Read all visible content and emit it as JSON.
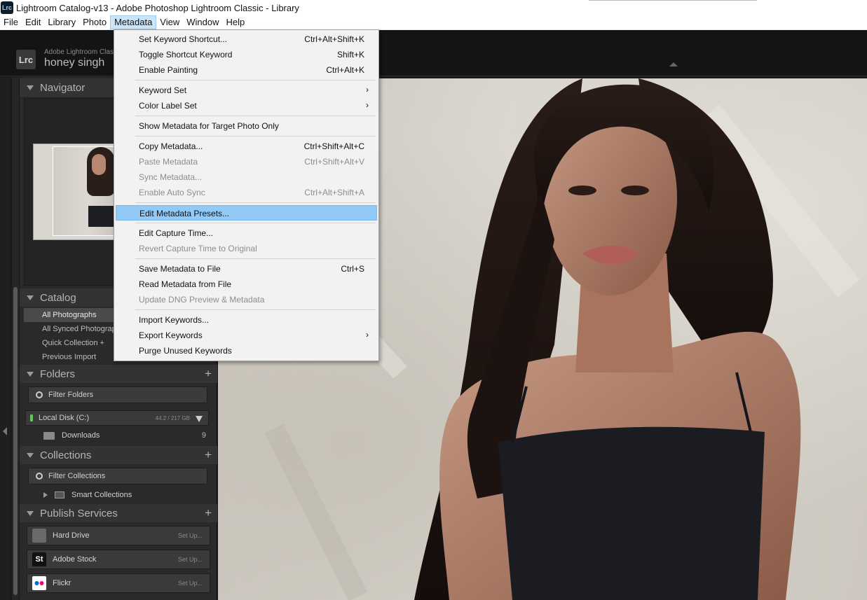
{
  "window": {
    "app_icon": "Lrc",
    "title": "Lightroom Catalog-v13 - Adobe Photoshop Lightroom Classic - Library"
  },
  "menubar": {
    "items": [
      "File",
      "Edit",
      "Library",
      "Photo",
      "Metadata",
      "View",
      "Window",
      "Help"
    ],
    "active": "Metadata"
  },
  "identity": {
    "logo": "Lrc",
    "product": "Adobe Lightroom Class",
    "user": "honey singh"
  },
  "panels": {
    "navigator": "Navigator",
    "catalog": {
      "title": "Catalog",
      "items": [
        "All Photographs",
        "All Synced Photographs",
        "Quick Collection  +",
        "Previous Import"
      ],
      "selected": "All Photographs"
    },
    "folders": {
      "title": "Folders",
      "filter_placeholder": "Filter Folders",
      "disk_name": "Local Disk (C:)",
      "disk_size": "44.2 / 217 GB",
      "folder_name": "Downloads",
      "folder_count": "9"
    },
    "collections": {
      "title": "Collections",
      "filter_placeholder": "Filter Collections",
      "set_name": "Smart Collections"
    },
    "publish": {
      "title": "Publish Services",
      "services": [
        {
          "name": "Hard Drive",
          "setup": "Set Up..."
        },
        {
          "name": "Adobe Stock",
          "setup": "Set Up...",
          "icon_text": "St"
        },
        {
          "name": "Flickr",
          "setup": "Set Up..."
        }
      ]
    }
  },
  "metadata_menu": {
    "items": [
      {
        "label": "Set Keyword Shortcut...",
        "shortcut": "Ctrl+Alt+Shift+K"
      },
      {
        "label": "Toggle Shortcut Keyword",
        "shortcut": "Shift+K"
      },
      {
        "label": "Enable Painting",
        "shortcut": "Ctrl+Alt+K"
      },
      {
        "label": "Keyword Set",
        "submenu": true
      },
      {
        "label": "Color Label Set",
        "submenu": true
      },
      {
        "label": "Show Metadata for Target Photo Only"
      },
      {
        "label": "Copy Metadata...",
        "shortcut": "Ctrl+Shift+Alt+C"
      },
      {
        "label": "Paste Metadata",
        "shortcut": "Ctrl+Shift+Alt+V",
        "disabled": true
      },
      {
        "label": "Sync Metadata...",
        "disabled": true
      },
      {
        "label": "Enable Auto Sync",
        "shortcut": "Ctrl+Alt+Shift+A",
        "disabled": true
      },
      {
        "label": "Edit Metadata Presets...",
        "highlighted": true
      },
      {
        "label": "Edit Capture Time..."
      },
      {
        "label": "Revert Capture Time to Original",
        "disabled": true
      },
      {
        "label": "Save Metadata to File",
        "shortcut": "Ctrl+S"
      },
      {
        "label": "Read Metadata from File"
      },
      {
        "label": "Update DNG Preview & Metadata",
        "disabled": true
      },
      {
        "label": "Import Keywords..."
      },
      {
        "label": "Export Keywords",
        "submenu": true
      },
      {
        "label": "Purge Unused Keywords"
      }
    ]
  },
  "colors": {
    "menu_highlight": "#91c9f7",
    "active_menu": "#cce4f7",
    "panel_bg": "#2a2a2a",
    "disk_led": "#5ec85e",
    "flickr_blue": "#0063dc",
    "flickr_pink": "#ff0084"
  }
}
